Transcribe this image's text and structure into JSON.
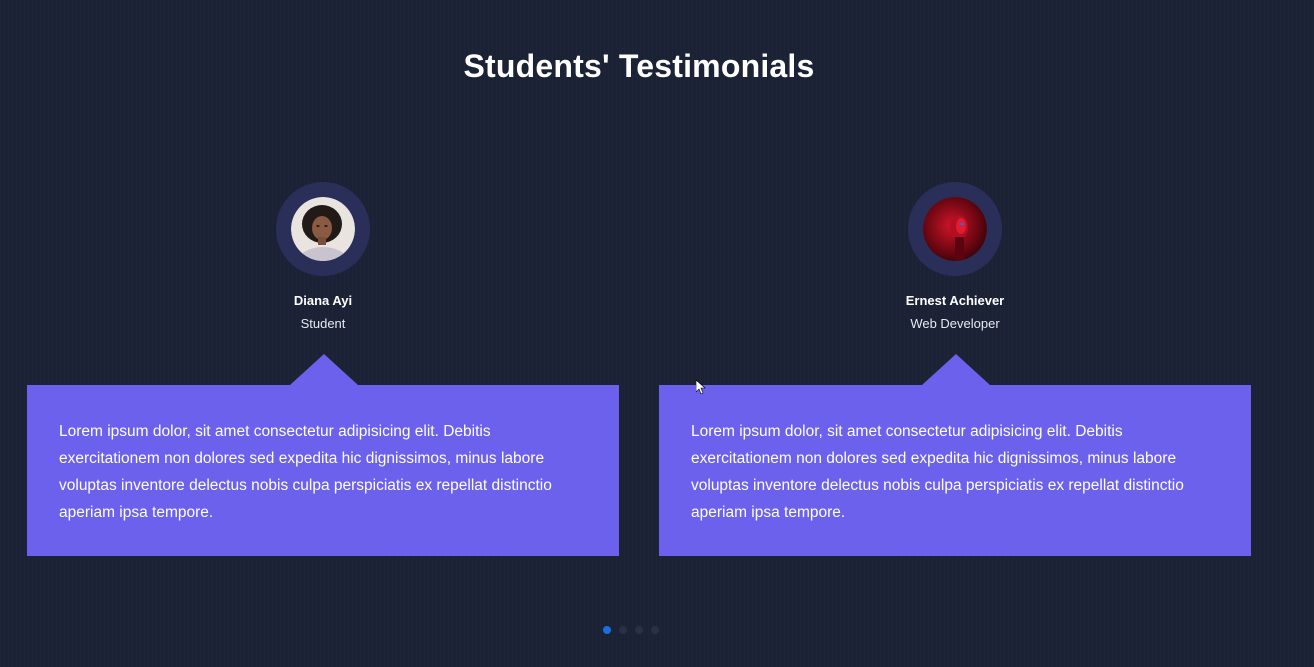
{
  "page": {
    "title": "Students' Testimonials"
  },
  "testimonials": [
    {
      "name": "Diana Ayi",
      "role": "Student",
      "avatar_icon": "student-portrait",
      "text": "Lorem ipsum dolor, sit amet consectetur adipisicing elit. Debitis exercitationem non dolores sed expedita hic dignissimos, minus labore voluptas inventore delectus nobis culpa perspiciatis ex repellat distinctio aperiam ipsa tempore."
    },
    {
      "name": "Ernest Achiever",
      "role": "Web Developer",
      "avatar_icon": "developer-portrait",
      "text": "Lorem ipsum dolor, sit amet consectetur adipisicing elit. Debitis exercitationem non dolores sed expedita hic dignissimos, minus labore voluptas inventore delectus nobis culpa perspiciatis ex repellat distinctio aperiam ipsa tempore."
    }
  ],
  "pagination": {
    "active_index": 0
  },
  "colors": {
    "background": "#1c2235",
    "card": "#6c61ec",
    "avatar_ring": "#2a2f5a",
    "active_dot": "#1a6fe0"
  }
}
